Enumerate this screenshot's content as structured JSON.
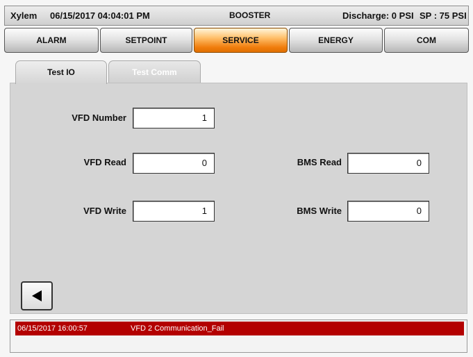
{
  "header": {
    "brand": "Xylem",
    "datetime": "06/15/2017 04:04:01 PM",
    "mode": "BOOSTER",
    "discharge": "Discharge: 0 PSI",
    "setpoint": "SP : 75 PSI"
  },
  "nav": {
    "tabs": [
      {
        "label": "ALARM"
      },
      {
        "label": "SETPOINT"
      },
      {
        "label": "SERVICE"
      },
      {
        "label": "ENERGY"
      },
      {
        "label": "COM"
      }
    ],
    "active": "SERVICE"
  },
  "subtabs": {
    "test_io": "Test IO",
    "test_comm": "Test Comm",
    "active": "Test IO"
  },
  "fields": {
    "vfd_number": {
      "label": "VFD Number",
      "value": "1"
    },
    "vfd_read": {
      "label": "VFD Read",
      "value": "0"
    },
    "vfd_write": {
      "label": "VFD Write",
      "value": "1"
    },
    "bms_read": {
      "label": "BMS Read",
      "value": "0"
    },
    "bms_write": {
      "label": "BMS Write",
      "value": "0"
    }
  },
  "alarm": {
    "timestamp": "06/15/2017 16:00:57",
    "message": "VFD 2 Communication_Fail",
    "color": "#b30000"
  },
  "icons": {
    "back": "back-arrow-icon"
  },
  "colors": {
    "active_tab": "#f07d0c",
    "panel": "#d5d5d5"
  }
}
